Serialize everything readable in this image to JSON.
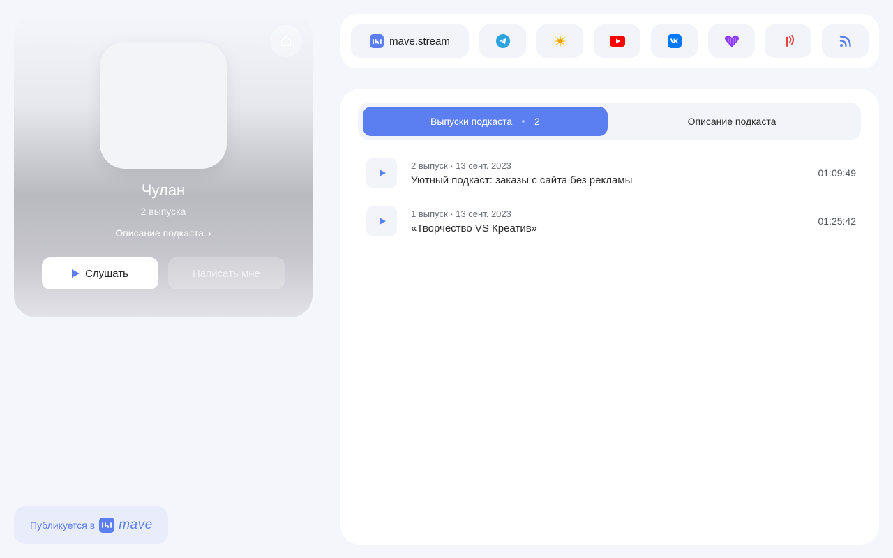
{
  "podcast": {
    "title": "Чулан",
    "episode_count": "2 выпуска",
    "description_link": "Описание подкаста",
    "listen_label": "Слушать",
    "write_label": "Написать мне"
  },
  "published": {
    "label": "Публикуется в",
    "brand": "mave"
  },
  "platforms": [
    {
      "name": "mave.stream",
      "icon": "mave-icon"
    },
    {
      "name": "Telegram",
      "icon": "telegram-icon",
      "color": "#2aa3df"
    },
    {
      "name": "Yandex Music",
      "icon": "yandex-music-icon",
      "color": "#f7c21c"
    },
    {
      "name": "YouTube",
      "icon": "youtube-icon",
      "color": "#ff0000"
    },
    {
      "name": "VK",
      "icon": "vk-icon",
      "color": "#0077ff"
    },
    {
      "name": "Zvuk",
      "icon": "zvuk-icon",
      "color": "#8e3bff"
    },
    {
      "name": "Castbox",
      "icon": "podcast-icon",
      "color": "#e5423f"
    },
    {
      "name": "RSS",
      "icon": "rss-icon",
      "color": "#5b7ff0"
    }
  ],
  "tabs": {
    "episodes_label": "Выпуски подкаста",
    "episodes_count": "2",
    "description_label": "Описание подкаста"
  },
  "episodes": [
    {
      "meta": "2 выпуск · 13 сент. 2023",
      "title": "Уютный подкаст: заказы с сайта без рекламы",
      "duration": "01:09:49"
    },
    {
      "meta": "1 выпуск · 13 сент. 2023",
      "title": "«Творчество VS Креатив»",
      "duration": "01:25:42"
    }
  ],
  "colors": {
    "accent": "#5b7ff0",
    "background": "#f4f6fb"
  }
}
